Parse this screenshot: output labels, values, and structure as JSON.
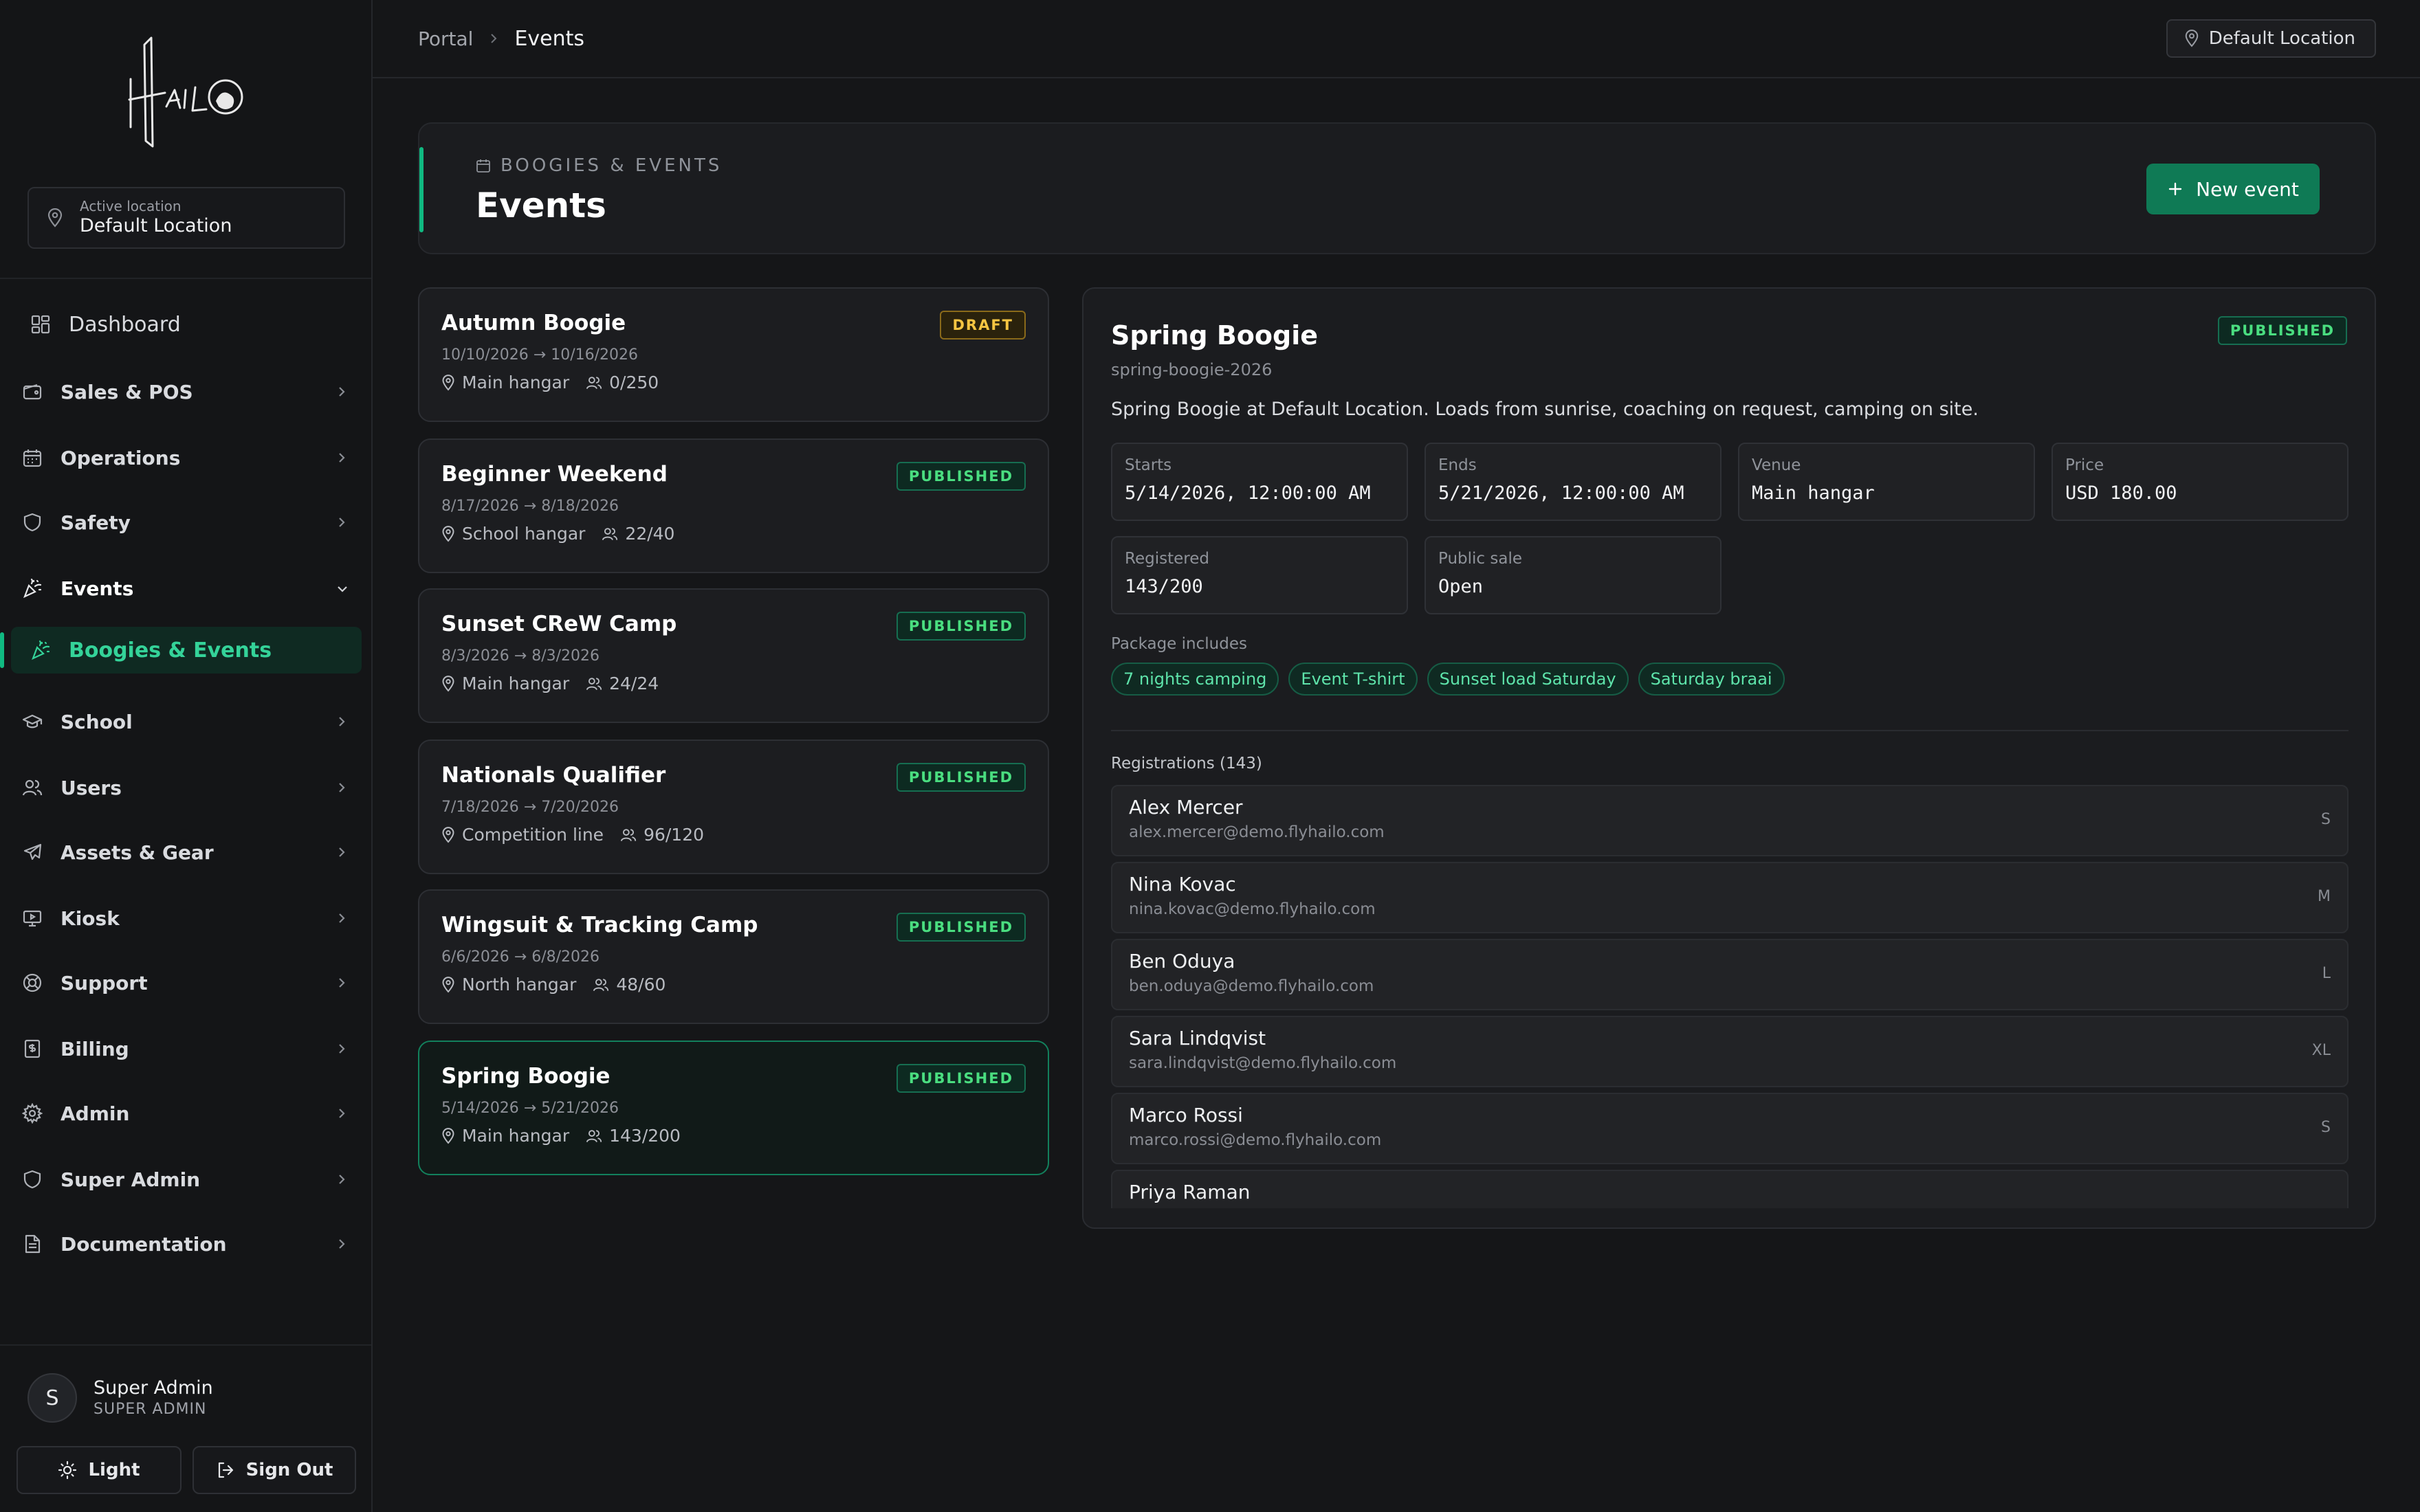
{
  "sidebar": {
    "location": {
      "small": "Active location",
      "name": "Default Location"
    },
    "nav": [
      {
        "label": "Dashboard",
        "icon": "dashboard-icon"
      },
      {
        "label": "Sales & POS",
        "icon": "wallet-icon"
      },
      {
        "label": "Operations",
        "icon": "calendar-icon"
      },
      {
        "label": "Safety",
        "icon": "shield-icon"
      },
      {
        "label": "Events",
        "icon": "party-popper-icon",
        "expanded": true
      },
      {
        "label": "Boogies & Events",
        "icon": "party-popper-icon",
        "active": true
      },
      {
        "label": "School",
        "icon": "graduation-cap-icon"
      },
      {
        "label": "Users",
        "icon": "users-icon"
      },
      {
        "label": "Assets & Gear",
        "icon": "plane-icon"
      },
      {
        "label": "Kiosk",
        "icon": "monitor-icon"
      },
      {
        "label": "Support",
        "icon": "lifebuoy-icon"
      },
      {
        "label": "Billing",
        "icon": "receipt-icon"
      },
      {
        "label": "Admin",
        "icon": "gear-icon"
      },
      {
        "label": "Super Admin",
        "icon": "shield-icon"
      },
      {
        "label": "Documentation",
        "icon": "document-icon"
      }
    ],
    "user": {
      "initial": "S",
      "name": "Super Admin",
      "role": "SUPER ADMIN"
    },
    "footer": {
      "theme_label": "Light",
      "signout_label": "Sign Out"
    }
  },
  "topbar": {
    "breadcrumb": [
      "Portal",
      "Events"
    ],
    "location_label": "Default Location"
  },
  "header": {
    "eyebrow": "BOOGIES & EVENTS",
    "title": "Events",
    "new_button": "New event"
  },
  "events": [
    {
      "name": "Autumn Boogie",
      "dates": "10/10/2026 → 10/16/2026",
      "venue": "Main hangar",
      "capacity": "0/250",
      "status": "DRAFT"
    },
    {
      "name": "Beginner Weekend",
      "dates": "8/17/2026 → 8/18/2026",
      "venue": "School hangar",
      "capacity": "22/40",
      "status": "PUBLISHED"
    },
    {
      "name": "Sunset CReW Camp",
      "dates": "8/3/2026 → 8/3/2026",
      "venue": "Main hangar",
      "capacity": "24/24",
      "status": "PUBLISHED"
    },
    {
      "name": "Nationals Qualifier",
      "dates": "7/18/2026 → 7/20/2026",
      "venue": "Competition line",
      "capacity": "96/120",
      "status": "PUBLISHED"
    },
    {
      "name": "Wingsuit & Tracking Camp",
      "dates": "6/6/2026 → 6/8/2026",
      "venue": "North hangar",
      "capacity": "48/60",
      "status": "PUBLISHED"
    },
    {
      "name": "Spring Boogie",
      "dates": "5/14/2026 → 5/21/2026",
      "venue": "Main hangar",
      "capacity": "143/200",
      "status": "PUBLISHED",
      "selected": true
    }
  ],
  "detail": {
    "title": "Spring Boogie",
    "slug": "spring-boogie-2026",
    "status": "PUBLISHED",
    "description": "Spring Boogie at Default Location. Loads from sunrise, coaching on request, camping on site.",
    "stats": [
      {
        "label": "Starts",
        "value": "5/14/2026, 12:00:00 AM"
      },
      {
        "label": "Ends",
        "value": "5/21/2026, 12:00:00 AM"
      },
      {
        "label": "Venue",
        "value": "Main hangar"
      },
      {
        "label": "Price",
        "value": "USD 180.00"
      },
      {
        "label": "Registered",
        "value": "143/200"
      },
      {
        "label": "Public sale",
        "value": "Open"
      }
    ],
    "package_label": "Package includes",
    "package": [
      "7 nights camping",
      "Event T-shirt",
      "Sunset load Saturday",
      "Saturday braai"
    ],
    "registrations_label": "Registrations (143)",
    "registrations": [
      {
        "name": "Alex Mercer",
        "email": "alex.mercer@demo.flyhailo.com",
        "size": "S"
      },
      {
        "name": "Nina Kovac",
        "email": "nina.kovac@demo.flyhailo.com",
        "size": "M"
      },
      {
        "name": "Ben Oduya",
        "email": "ben.oduya@demo.flyhailo.com",
        "size": "L"
      },
      {
        "name": "Sara Lindqvist",
        "email": "sara.lindqvist@demo.flyhailo.com",
        "size": "XL"
      },
      {
        "name": "Marco Rossi",
        "email": "marco.rossi@demo.flyhailo.com",
        "size": "S"
      },
      {
        "name": "Priya Raman",
        "email": "",
        "size": ""
      }
    ]
  },
  "colors": {
    "accent": "#10b981",
    "accent_text": "#34d399",
    "draft": "#f5c542",
    "background": "#151618"
  }
}
